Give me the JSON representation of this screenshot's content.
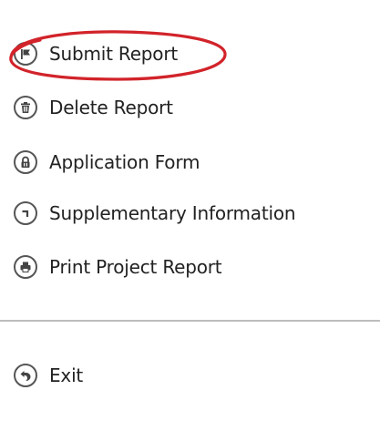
{
  "menu": {
    "items": [
      {
        "label": "Submit Report",
        "icon": "flag-icon"
      },
      {
        "label": "Delete Report",
        "icon": "trash-icon"
      },
      {
        "label": "Application Form",
        "icon": "lock-icon"
      },
      {
        "label": "Supplementary Information",
        "icon": "corner-arrow-icon"
      },
      {
        "label": "Print Project Report",
        "icon": "print-icon"
      }
    ],
    "exit": {
      "label": "Exit",
      "icon": "back-arrow-icon"
    }
  },
  "colors": {
    "icon_stroke": "#555555",
    "text": "#222222",
    "divider": "#bdbdbd",
    "highlight": "#d2232a"
  }
}
